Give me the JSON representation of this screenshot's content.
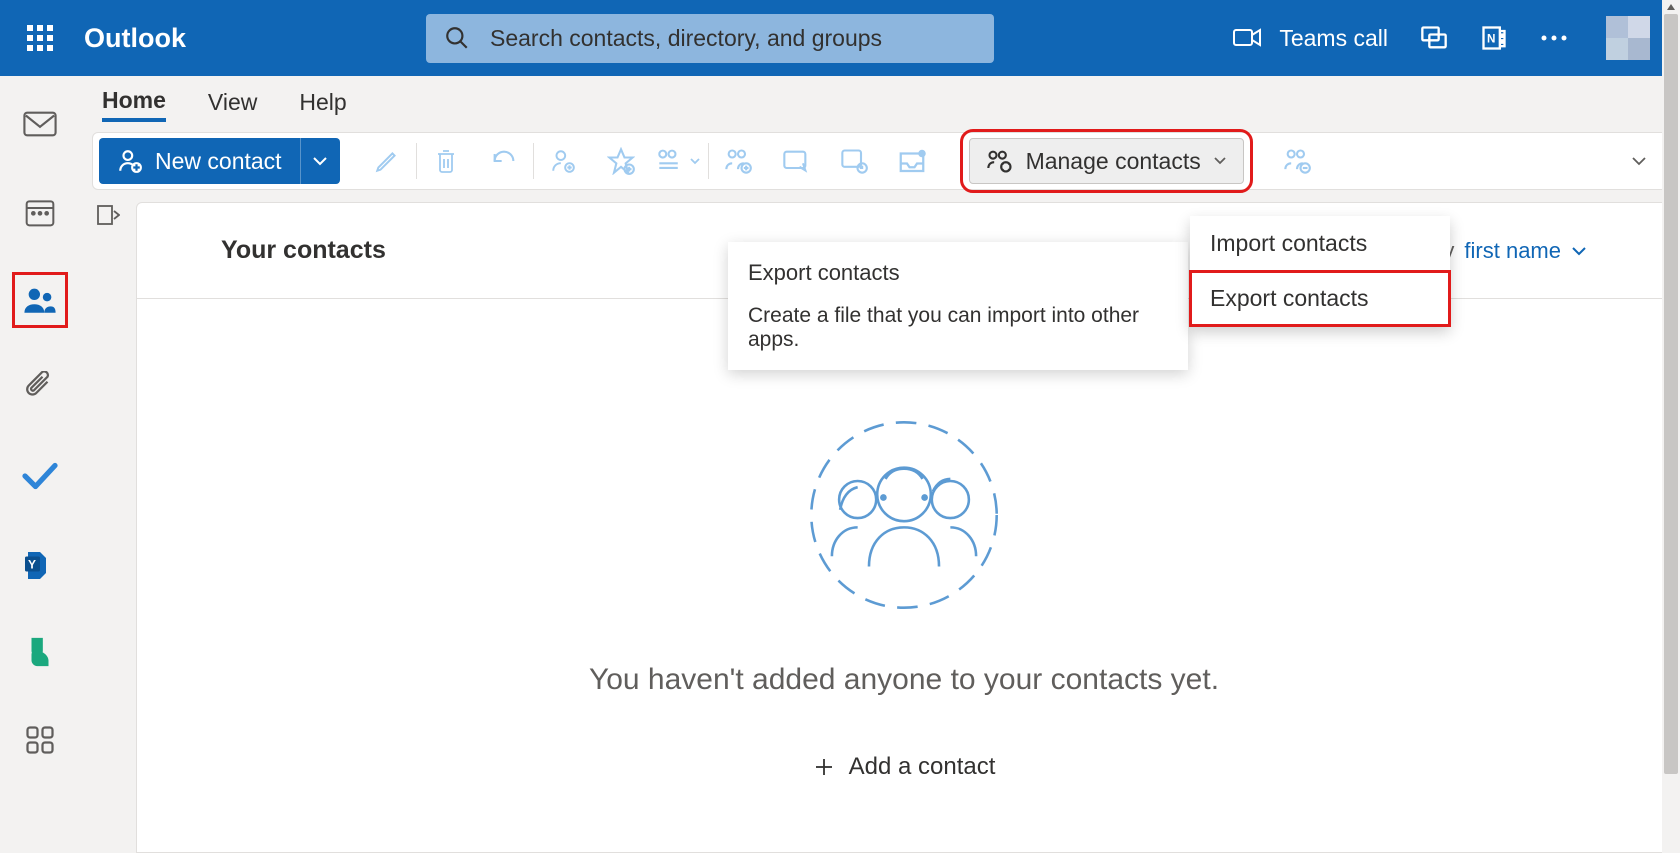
{
  "header": {
    "brand": "Outlook",
    "search_placeholder": "Search contacts, directory, and groups",
    "teams_call": "Teams call"
  },
  "tabs": {
    "home": "Home",
    "view": "View",
    "help": "Help"
  },
  "toolbar": {
    "new_contact": "New contact",
    "manage_contacts": "Manage contacts"
  },
  "dropdown": {
    "import": "Import contacts",
    "export": "Export contacts"
  },
  "tooltip": {
    "title": "Export contacts",
    "body": "Create a file that you can import into other apps."
  },
  "panel": {
    "title": "Your contacts",
    "sort_label": "By",
    "sort_value": "first name",
    "empty_text": "You haven't added anyone to your contacts yet.",
    "add_contact": "Add a contact"
  }
}
